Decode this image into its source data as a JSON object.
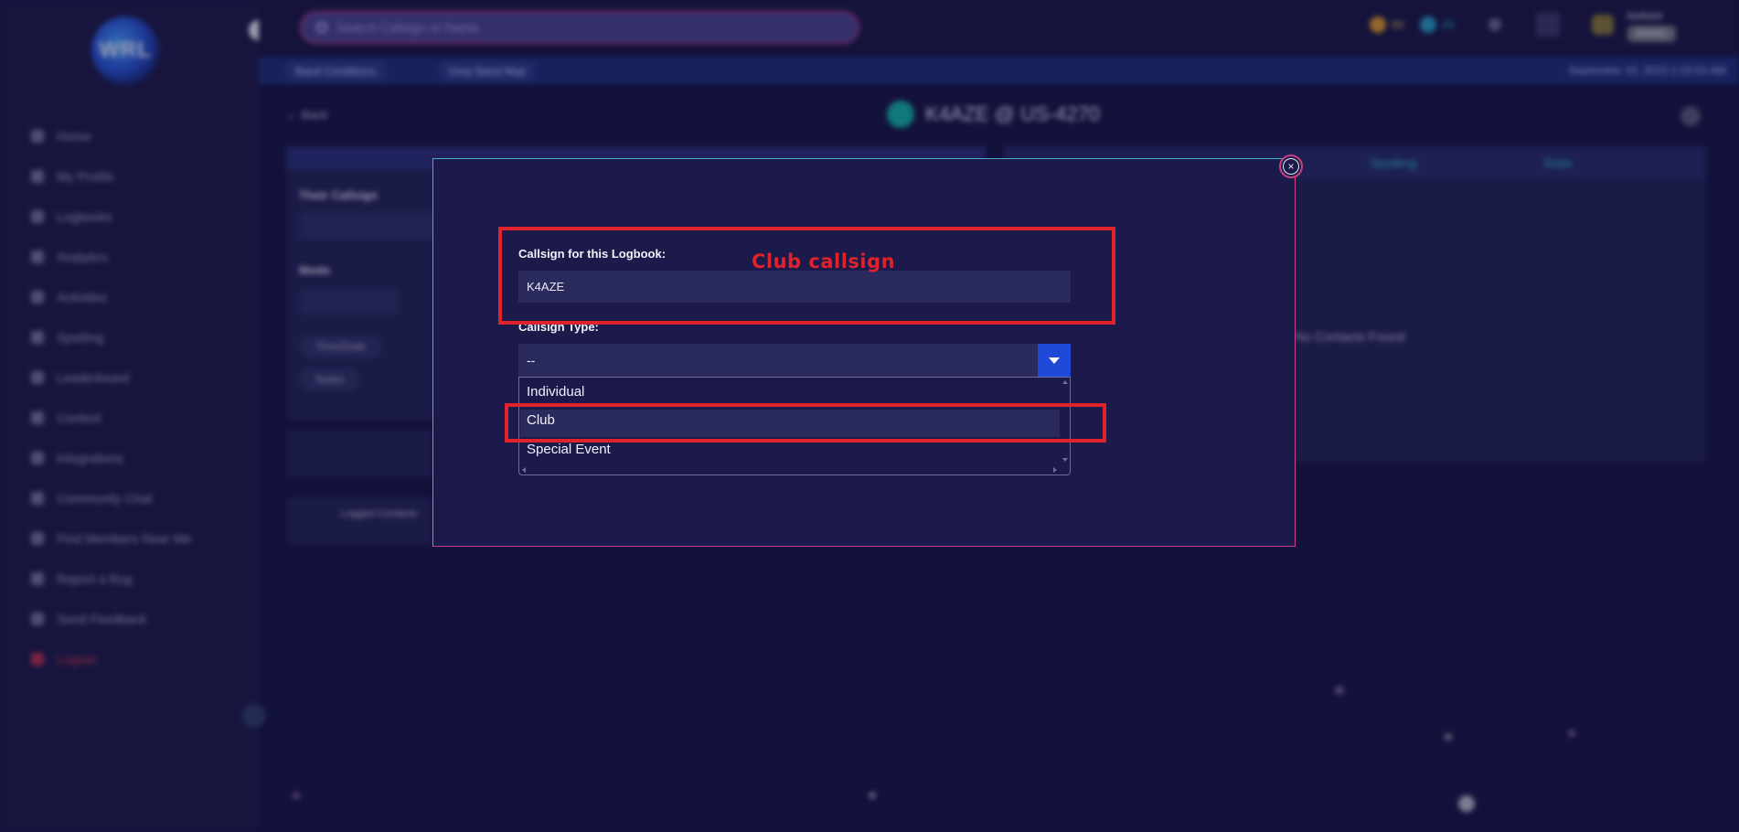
{
  "app": {
    "logo_text": "WRL",
    "search_placeholder": "Search Callsign or Name",
    "coins": "60",
    "points": "20",
    "user_name": "ka4aze",
    "user_tag": "BASIC",
    "subbar": {
      "band_conditions": "Band Conditions",
      "grey_line_map": "Grey Band Map",
      "date": "September 10, 2023 1:15:53 AM"
    },
    "back_label": "Back",
    "page_title": "K4AZE @ US-4270",
    "sidebar": [
      {
        "label": "Home"
      },
      {
        "label": "My Profile"
      },
      {
        "label": "Logbooks"
      },
      {
        "label": "Analytics"
      },
      {
        "label": "Activities"
      },
      {
        "label": "Spotting"
      },
      {
        "label": "Leaderboard"
      },
      {
        "label": "Contest"
      },
      {
        "label": "Integrations"
      },
      {
        "label": "Community Chat"
      },
      {
        "label": "Find Members Near Me"
      },
      {
        "label": "Report a Bug"
      },
      {
        "label": "Send Feedback"
      },
      {
        "label": "Logout"
      }
    ],
    "left_panel": {
      "their_callsign": "Their Callsign",
      "mode": "Mode",
      "time_date": "Time/Date",
      "notes": "Notes",
      "logged_contacts": "Logged Contacts"
    },
    "right_panel": {
      "spotting_tab": "Spotting",
      "stats_tab": "Stats",
      "empty": "No Contacts Found"
    }
  },
  "modal": {
    "callsign_label": "Callsign for this Logbook:",
    "callsign_value": "K4AZE",
    "type_label": "Callsign Type:",
    "type_selected": "--",
    "options": [
      "Individual",
      "Club",
      "Special Event"
    ],
    "close_glyph": "×"
  },
  "annotations": {
    "callsign_note": "Club callsign"
  },
  "colors": {
    "annotation": "#e0222b",
    "modal_bg": "#1b1a4a",
    "select_button": "#1f49d8",
    "page_bg": "#1a1747"
  }
}
